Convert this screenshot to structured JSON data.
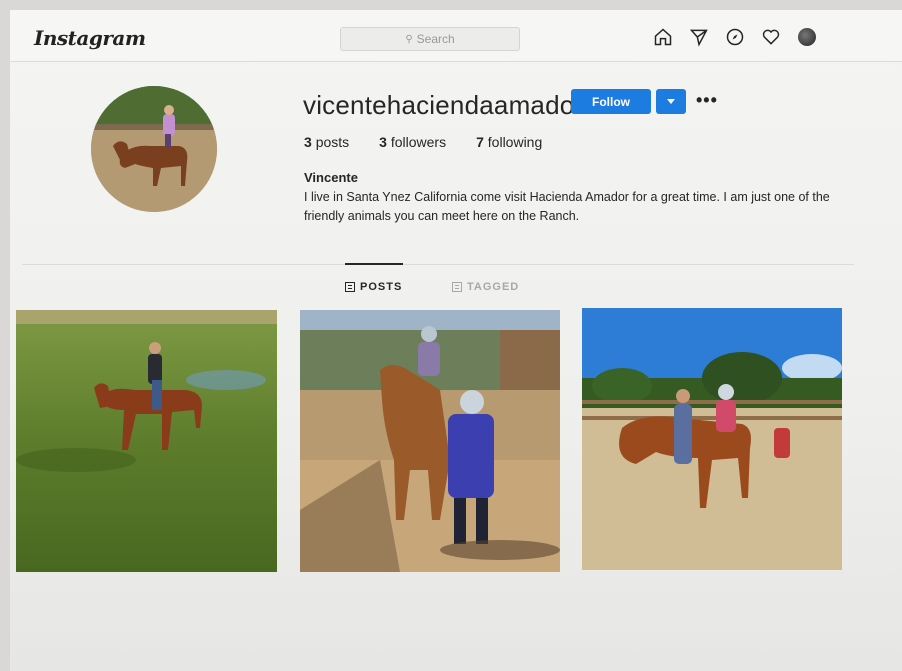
{
  "header": {
    "logo": "Instagram",
    "search_placeholder": "Search",
    "nav_icons": [
      "home-icon",
      "direct-icon",
      "explore-icon",
      "activity-heart-icon",
      "profile-avatar-icon"
    ]
  },
  "profile": {
    "username": "vicentehaciendaamador",
    "follow_label": "Follow",
    "more_label": "•••",
    "stats": {
      "posts_count": "3",
      "posts_label": "posts",
      "followers_count": "3",
      "followers_label": "followers",
      "following_count": "7",
      "following_label": "following"
    },
    "full_name": "Vincente",
    "bio": "I live in Santa Ynez California come visit Hacienda Amador for a great time. I am just one of the friendly animals you can meet here on the Ranch."
  },
  "tabs": [
    {
      "label": "POSTS",
      "active": true
    },
    {
      "label": "TAGGED",
      "active": false
    }
  ],
  "colors": {
    "accent": "#1d7ce0",
    "text": "#262626"
  }
}
